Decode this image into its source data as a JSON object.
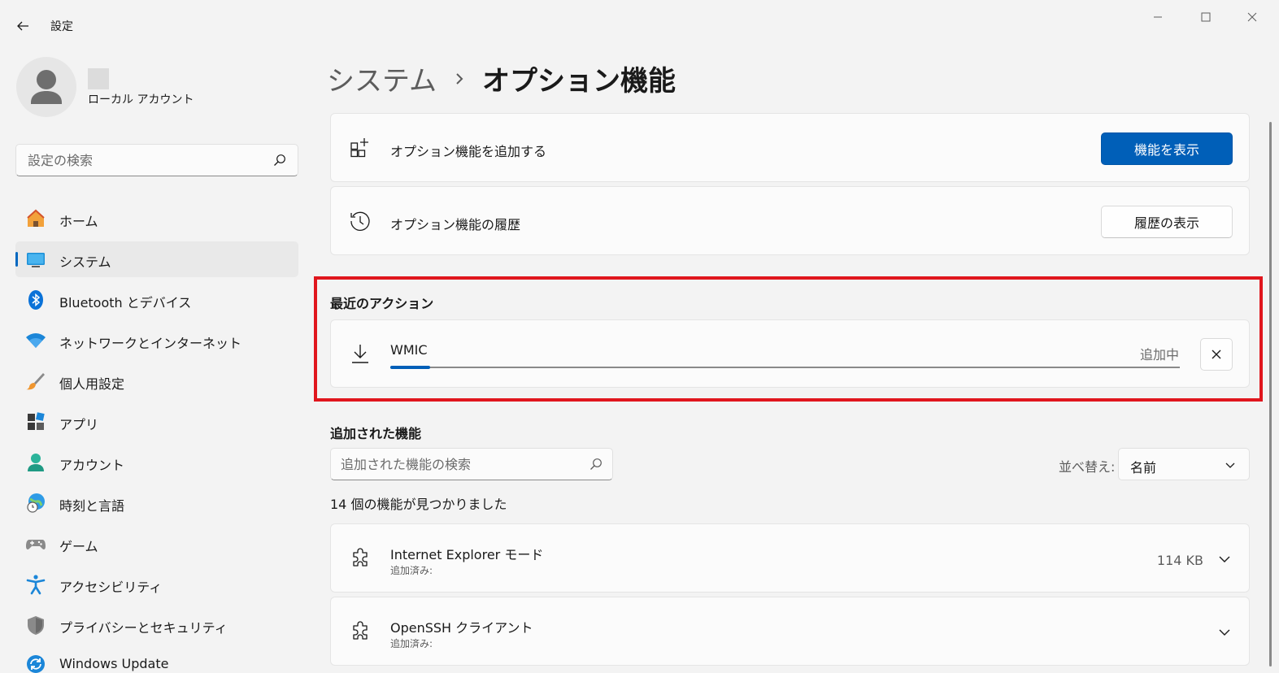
{
  "window": {
    "title": "設定",
    "controls": [
      "minimize-icon",
      "maximize-icon",
      "close-icon"
    ]
  },
  "profile": {
    "account_type": "ローカル アカウント"
  },
  "sidebar_search": {
    "placeholder": "設定の検索"
  },
  "nav": {
    "items": [
      {
        "label": "ホーム",
        "icon": "home-icon"
      },
      {
        "label": "システム",
        "icon": "system-icon",
        "active": true
      },
      {
        "label": "Bluetooth とデバイス",
        "icon": "bluetooth-icon"
      },
      {
        "label": "ネットワークとインターネット",
        "icon": "wifi-icon"
      },
      {
        "label": "個人用設定",
        "icon": "brush-icon"
      },
      {
        "label": "アプリ",
        "icon": "apps-icon"
      },
      {
        "label": "アカウント",
        "icon": "account-icon"
      },
      {
        "label": "時刻と言語",
        "icon": "globe-clock-icon"
      },
      {
        "label": "ゲーム",
        "icon": "gamepad-icon"
      },
      {
        "label": "アクセシビリティ",
        "icon": "accessibility-icon"
      },
      {
        "label": "プライバシーとセキュリティ",
        "icon": "shield-icon"
      },
      {
        "label": "Windows Update",
        "icon": "update-icon"
      }
    ]
  },
  "breadcrumb": {
    "parent": "システム",
    "current": "オプション機能"
  },
  "add_card": {
    "label": "オプション機能を追加する",
    "button": "機能を表示"
  },
  "history_card": {
    "label": "オプション機能の履歴",
    "button": "履歴の表示"
  },
  "recent_actions": {
    "title": "最近のアクション",
    "item": {
      "name": "WMIC",
      "status": "追加中",
      "progress": 0.05
    }
  },
  "added_features": {
    "title": "追加された機能",
    "search_placeholder": "追加された機能の検索",
    "sort_label": "並べ替え:",
    "sort_value": "名前",
    "count_text": "14 個の機能が見つかりました",
    "items": [
      {
        "name": "Internet Explorer モード",
        "status": "追加済み:",
        "size": "114 KB"
      },
      {
        "name": "OpenSSH クライアント",
        "status": "追加済み:",
        "size": ""
      }
    ]
  },
  "colors": {
    "accent": "#005fb8",
    "highlight_border": "#e0161d",
    "background": "#f3f3f3",
    "card": "#fbfbfb"
  }
}
